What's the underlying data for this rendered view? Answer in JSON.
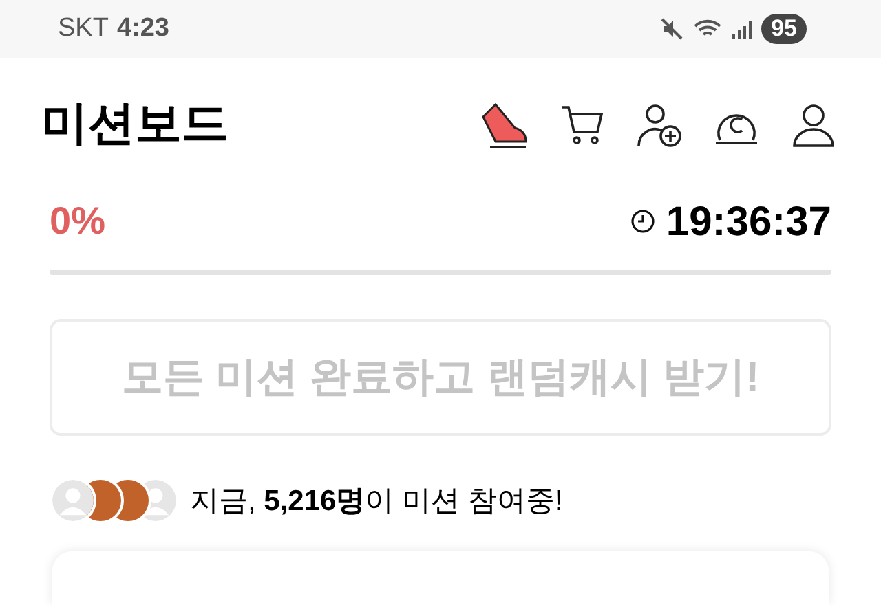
{
  "status_bar": {
    "carrier": "SKT",
    "time": "4:23",
    "battery": "95"
  },
  "header": {
    "title": "미션보드"
  },
  "progress": {
    "percent": "0%",
    "level": 0
  },
  "timer": "19:36:37",
  "mission_button": {
    "label": "모든 미션 완료하고 랜덤캐시 받기!",
    "disabled": true
  },
  "participants": {
    "avatars": [
      {
        "kind": "default"
      },
      {
        "kind": "photo"
      },
      {
        "kind": "photo"
      },
      {
        "kind": "default"
      }
    ],
    "text": "지금, **5,216명**이 미션 참여중!"
  }
}
